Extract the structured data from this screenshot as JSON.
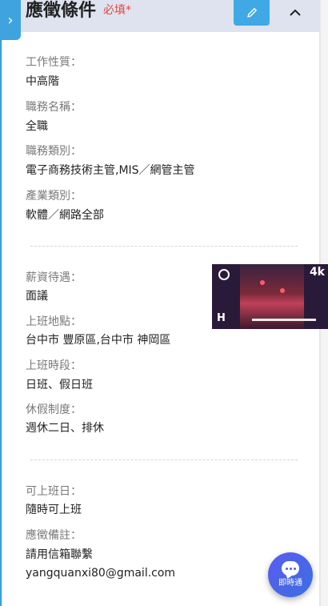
{
  "header": {
    "title": "應徵條件",
    "required_label": "必填*",
    "edit_icon": "pencil-icon",
    "collapse_icon": "chevron-up-icon",
    "side_tab_icon": "chevron-right-icon"
  },
  "section1": {
    "job_nature": {
      "label": "工作性質：",
      "value": "中高階"
    },
    "position_title": {
      "label": "職務名稱：",
      "value": "全職"
    },
    "job_category": {
      "label": "職務類別：",
      "value": "電子商務技術主管,MIS／網管主管"
    },
    "industry": {
      "label": "產業類別：",
      "value": "軟體／網路全部"
    }
  },
  "section2": {
    "salary": {
      "label": "薪資待遇：",
      "value": "面議"
    },
    "location": {
      "label": "上班地點：",
      "value": "台中市 豐原區,台中市 神岡區"
    },
    "shift": {
      "label": "上班時段：",
      "value": "日班、假日班"
    },
    "holiday": {
      "label": "休假制度：",
      "value": "週休二日、排休"
    }
  },
  "section3": {
    "start_date": {
      "label": "可上班日：",
      "value": "隨時可上班"
    },
    "remarks": {
      "label": "應徵備註：",
      "value_line1": "請用信箱聯繫",
      "value_line2": "yangquanxi80@gmail.com"
    }
  },
  "video": {
    "badge": "4k",
    "logo": "H"
  },
  "chat": {
    "label": "即時通",
    "icon": "chat-bubble-icon"
  },
  "colors": {
    "accent": "#3fa9e6",
    "required": "#e0483e",
    "header_bg": "#dfe3ef",
    "chat_button": "#4a60e6"
  }
}
